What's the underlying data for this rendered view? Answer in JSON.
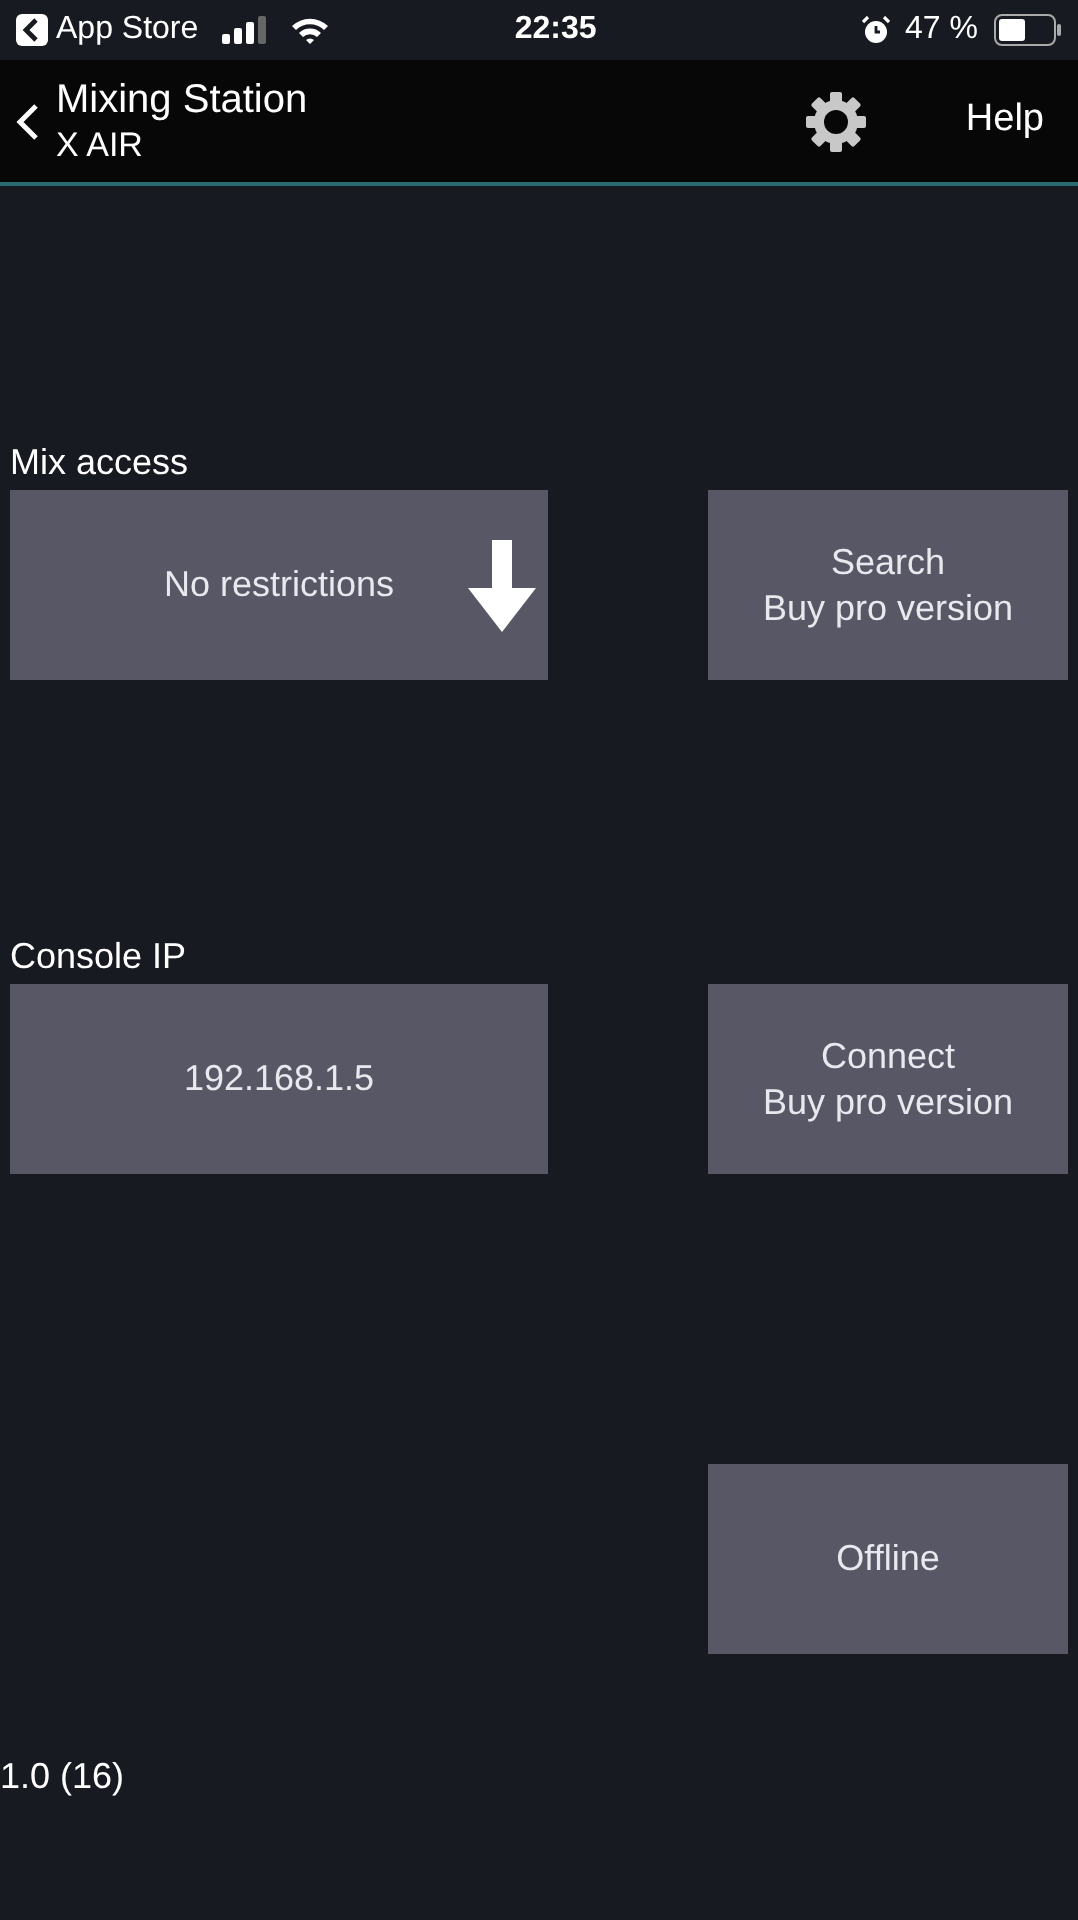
{
  "status_bar": {
    "back_app": "App Store",
    "time": "22:35",
    "battery": "47 %"
  },
  "header": {
    "title": "Mixing Station",
    "subtitle": "X AIR",
    "help": "Help"
  },
  "sections": [
    {
      "label": "Mix access",
      "field": {
        "value": "No restrictions",
        "dropdown": true
      },
      "action": [
        "Search",
        "Buy pro version"
      ]
    },
    {
      "label": "Console IP",
      "field": {
        "value": "192.168.1.5",
        "dropdown": false
      },
      "action": [
        "Connect",
        "Buy pro version"
      ]
    }
  ],
  "offline_button": [
    "Offline"
  ],
  "version": "1.0 (16)"
}
